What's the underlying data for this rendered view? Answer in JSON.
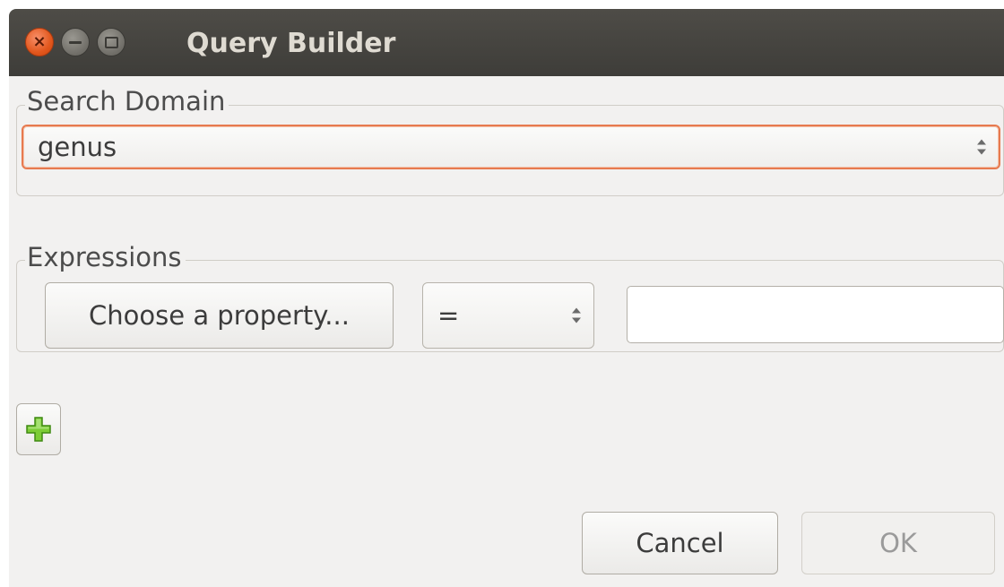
{
  "window": {
    "title": "Query Builder",
    "controls": {
      "close_icon": "close-icon",
      "minimize_icon": "minimize-icon",
      "maximize_icon": "maximize-icon"
    }
  },
  "search_domain": {
    "legend": "Search Domain",
    "selected": "genus"
  },
  "expressions": {
    "legend": "Expressions",
    "property_button_label": "Choose a property...",
    "operator_selected": "=",
    "value": ""
  },
  "add_expression": {
    "icon": "plus-icon",
    "color": "#6cbd2b"
  },
  "buttons": {
    "cancel_label": "Cancel",
    "ok_label": "OK"
  },
  "colors": {
    "titlebar": "#3f3e3a",
    "close_button": "#e95420",
    "focus_border": "#e77a4f",
    "dialog_background": "#f2f1f0"
  }
}
